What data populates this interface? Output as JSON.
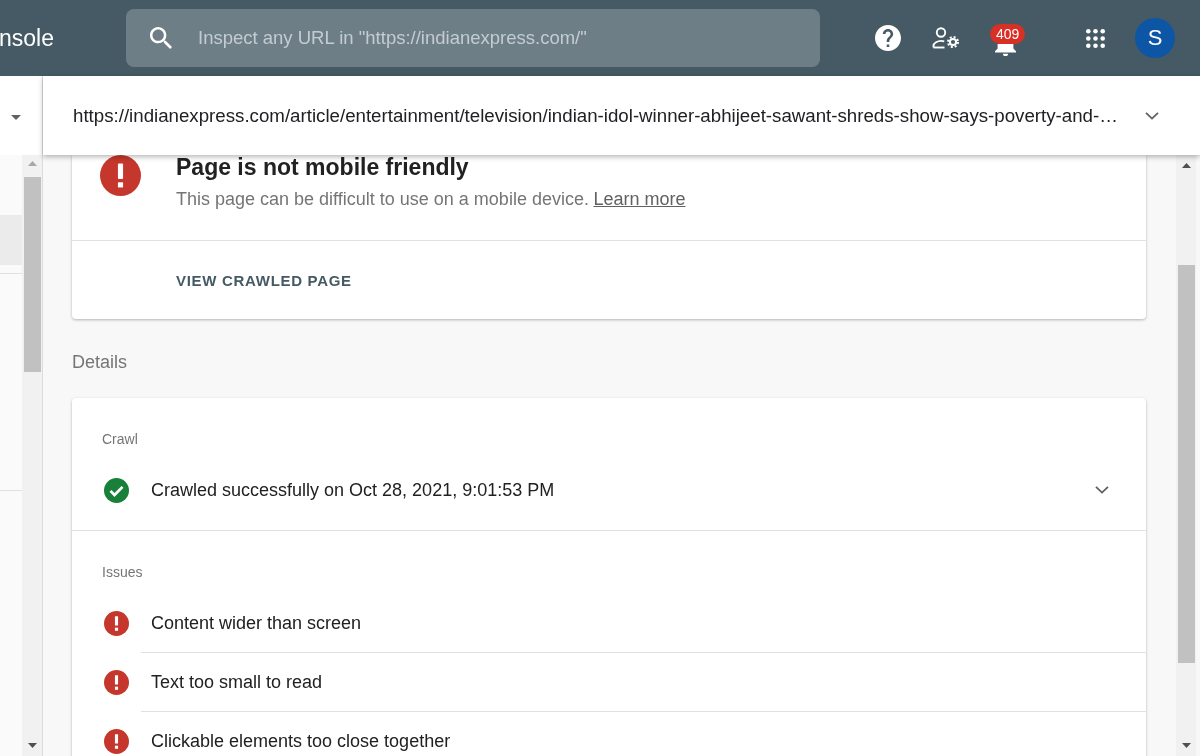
{
  "top_bar": {
    "app_title": "nsole",
    "search": {
      "placeholder": "Inspect any URL in \"https://indianexpress.com/\""
    },
    "notifications": {
      "count": "409"
    },
    "avatar": {
      "letter": "S"
    }
  },
  "sidebar": {
    "items": [
      {
        "selected": true
      }
    ]
  },
  "url_bar": {
    "url": "https://indianexpress.com/article/entertainment/television/indian-idol-winner-abhijeet-sawant-shreds-show-says-poverty-and-…"
  },
  "verdict_card": {
    "kind": "error",
    "title": "Page is not mobile friendly",
    "description": "This page can be difficult to use on a mobile device.",
    "link": "Learn more",
    "action": "VIEW CRAWLED PAGE"
  },
  "details": {
    "heading": "Details",
    "sections": [
      {
        "label": "Crawl",
        "rows": [
          {
            "kind": "success",
            "text": "Crawled successfully on Oct 28, 2021, 9:01:53 PM",
            "expanded": false
          }
        ]
      },
      {
        "label": "Issues",
        "rows": [
          {
            "kind": "error",
            "text": "Content wider than screen"
          },
          {
            "kind": "error",
            "text": "Text too small to read"
          },
          {
            "kind": "error",
            "text": "Clickable elements too close together"
          }
        ]
      }
    ]
  }
}
